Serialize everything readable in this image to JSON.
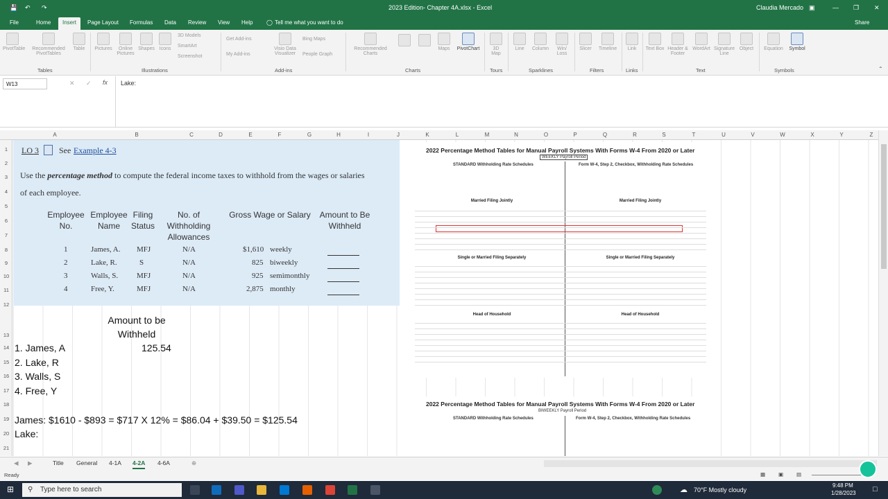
{
  "window": {
    "file_title": "2023 Edition- Chapter 4A.xlsx  -  Excel",
    "user": "Claudia Mercado",
    "share": "Share"
  },
  "ribbon_tabs": [
    "File",
    "Home",
    "Insert",
    "Page Layout",
    "Formulas",
    "Data",
    "Review",
    "View",
    "Help",
    "Tell me what you want to do"
  ],
  "ribbon_groups": {
    "tables": "Tables",
    "illustrations": "Illustrations",
    "addins": "Add-ins",
    "charts": "Charts",
    "tours": "Tours",
    "sparklines": "Sparklines",
    "filters": "Filters",
    "links": "Links",
    "text": "Text",
    "symbols": "Symbols"
  },
  "ribbon_buttons": {
    "pivottable": "PivotTable",
    "recommended_pivottables": "Recommended PivotTables",
    "table": "Table",
    "pictures": "Pictures",
    "online_pictures": "Online Pictures",
    "shapes": "Shapes",
    "icons": "Icons",
    "models_3d": "3D Models",
    "smartart": "SmartArt",
    "screenshot": "Screenshot",
    "get_addins": "Get Add-ins",
    "my_addins": "My Add-ins",
    "visio": "Visio Data Visualizer",
    "bing_maps": "Bing Maps",
    "people_graph": "People Graph",
    "recommended_charts": "Recommended Charts",
    "maps": "Maps",
    "pivotchart": "PivotChart",
    "map_3d": "3D Map",
    "line": "Line",
    "column": "Column",
    "winloss": "Win/ Loss",
    "slicer": "Slicer",
    "timeline": "Timeline",
    "link": "Link",
    "text_box": "Text Box",
    "header_footer": "Header & Footer",
    "wordart": "WordArt",
    "signature_line": "Signature Line",
    "object": "Object",
    "equation": "Equation",
    "symbol": "Symbol"
  },
  "formula_bar": {
    "name_box": "W13",
    "content": "Lake:"
  },
  "columns": [
    "A",
    "B",
    "C",
    "D",
    "E",
    "F",
    "G",
    "H",
    "I",
    "J",
    "K",
    "L",
    "M",
    "N",
    "O",
    "P",
    "Q",
    "R",
    "S",
    "T",
    "U",
    "V",
    "W",
    "X",
    "Y",
    "Z"
  ],
  "rows": [
    "1",
    "2",
    "3",
    "4",
    "5",
    "6",
    "7",
    "8",
    "9",
    "10",
    "11",
    "12",
    "13",
    "14",
    "15",
    "16",
    "17",
    "18",
    "19",
    "20",
    "21"
  ],
  "panel": {
    "lo": "LO 3",
    "see": "See",
    "example": "Example 4-3",
    "instruction_pre": "Use the",
    "instruction_em": "percentage method",
    "instruction_post": "to compute the federal income taxes to withhold from the wages or salaries",
    "instruction_line2": "of each employee.",
    "headers": {
      "emp_no": "Employee No.",
      "emp_name": "Employee Name",
      "filing": "Filing Status",
      "allowances": "No. of Withholding Allowances",
      "gross": "Gross Wage or Salary",
      "amount": "Amount to Be Withheld"
    },
    "employees": [
      {
        "no": "1",
        "name": "James, A.",
        "status": "MFJ",
        "allow": "N/A",
        "wage": "$1,610",
        "period": "weekly"
      },
      {
        "no": "2",
        "name": "Lake, R.",
        "status": "S",
        "allow": "N/A",
        "wage": "825",
        "period": "biweekly"
      },
      {
        "no": "3",
        "name": "Walls, S.",
        "status": "MFJ",
        "allow": "N/A",
        "wage": "925",
        "period": "semimonthly"
      },
      {
        "no": "4",
        "name": "Free, Y.",
        "status": "MFJ",
        "allow": "N/A",
        "wage": "2,875",
        "period": "monthly"
      }
    ]
  },
  "answers": {
    "header": "Amount to be Withheld",
    "rows": [
      {
        "label": "1. James, A",
        "value": "125.54"
      },
      {
        "label": "2. Lake, R",
        "value": ""
      },
      {
        "label": "3. Walls, S",
        "value": ""
      },
      {
        "label": "4. Free, Y",
        "value": ""
      }
    ],
    "james_calc": "James: $1610 - $893 = $717 X 12% = $86.04 + $39.50 = $125.54",
    "lake": "Lake:"
  },
  "tables": {
    "title1": "2022 Percentage Method Tables for Manual Payroll Systems With Forms W-4 From 2020 or Later",
    "period1": "WEEKLY Payroll Period",
    "std_head": "STANDARD Withholding Rate Schedules",
    "w4_head": "Form W-4, Step 2, Checkbox, Withholding Rate Schedules",
    "married": "Married Filing Jointly",
    "single": "Single or Married Filing Separately",
    "hoh": "Head of Household",
    "title2": "2022 Percentage Method Tables for Manual Payroll Systems With Forms W-4 From 2020 or Later",
    "period2": "BIWEEKLY Payroll Period"
  },
  "sheet_tabs": [
    "Title",
    "General",
    "4-1A",
    "4-2A",
    "4-6A"
  ],
  "active_sheet": "4-2A",
  "status": "Ready",
  "taskbar": {
    "search_placeholder": "Type here to search",
    "weather": "70°F  Mostly cloudy",
    "time": "9:48 PM",
    "date": "1/28/2023"
  }
}
